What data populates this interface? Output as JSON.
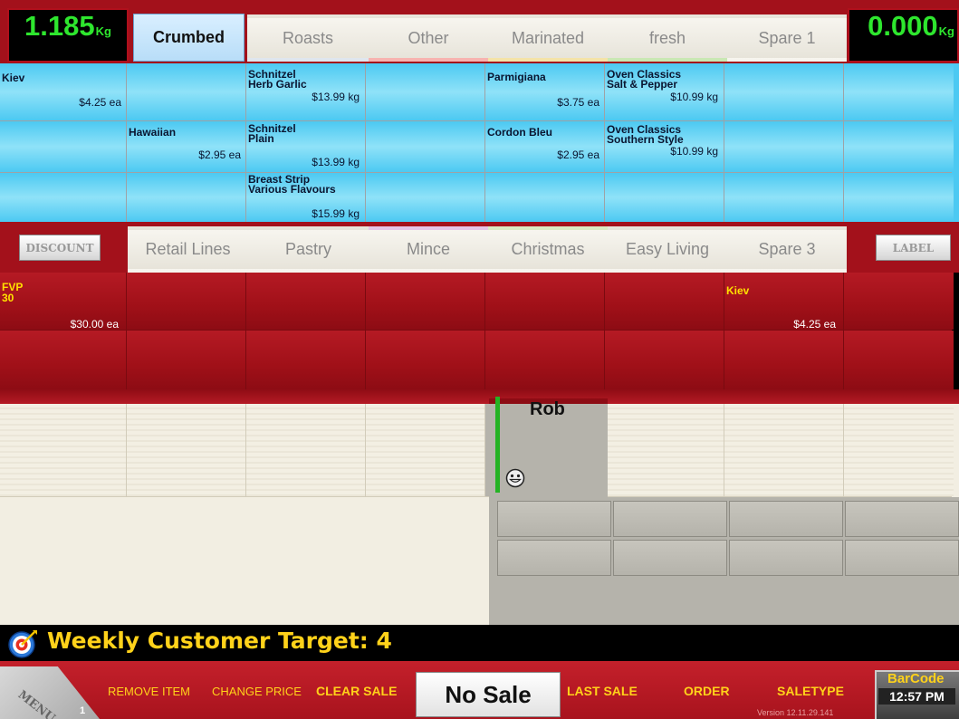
{
  "scale_left": {
    "value": "1.185",
    "unit": "Kg"
  },
  "scale_right": {
    "value": "0.000",
    "unit": "Kg"
  },
  "top_tabs": [
    "Crumbed",
    "Roasts",
    "Other",
    "Marinated",
    "fresh",
    "Spare 1"
  ],
  "products": [
    {
      "name": "Kiev",
      "price": "$4.25 ea"
    },
    {
      "name": "Hawaiian",
      "price": "$2.95 ea"
    },
    {
      "name": "Schnitzel\nHerb Garlic",
      "price": "$13.99 kg"
    },
    {
      "name": "Schnitzel\nPlain",
      "price": "$13.99 kg"
    },
    {
      "name": "Breast Strip\nVarious Flavours",
      "price": "$15.99 kg"
    },
    {
      "name": "Parmigiana",
      "price": "$3.75 ea"
    },
    {
      "name": "Cordon Bleu",
      "price": "$2.95 ea"
    },
    {
      "name": "Oven Classics\nSalt & Pepper",
      "price": "$10.99 kg"
    },
    {
      "name": "Oven Classics\nSouthern Style",
      "price": "$10.99 kg"
    }
  ],
  "mid_tabs": [
    "Retail Lines",
    "Pastry",
    "Mince",
    "Christmas",
    "Easy Living",
    "Spare 3"
  ],
  "discount_label": "DISCOUNT",
  "label_label": "LABEL",
  "red_items": [
    {
      "name": "FVP\n30",
      "price": "$30.00 ea"
    },
    {
      "name": "Kiev",
      "price": "$4.25 ea"
    }
  ],
  "operator": "Rob",
  "weekly_target": "Weekly Customer Target: 4",
  "menu_label": "MENU",
  "menu_count": "1",
  "bottom_buttons": [
    "REMOVE ITEM",
    "CHANGE PRICE",
    "CLEAR SALE",
    "No Sale",
    "LAST SALE",
    "ORDER",
    "SALETYPE"
  ],
  "barcode_label": "BarCode",
  "time": "12:57 PM",
  "version": "Version 12.11.29.141",
  "colors": {
    "scale_digits": "#2ee62e",
    "red_band": "#a81520",
    "product_blue": "#6fd6f5",
    "target_text": "#ffd21a"
  }
}
